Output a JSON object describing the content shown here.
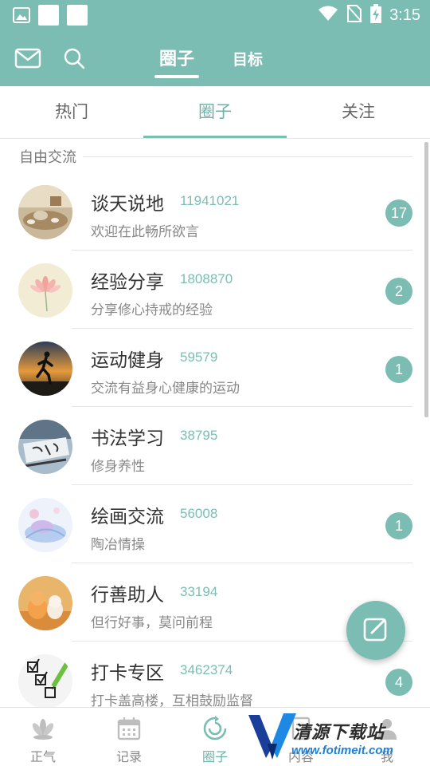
{
  "status_bar": {
    "time": "3:15"
  },
  "header": {
    "tabs": [
      {
        "label": "圈子",
        "active": true
      },
      {
        "label": "目标",
        "active": false
      }
    ]
  },
  "sub_tabs": [
    {
      "label": "热门",
      "active": false
    },
    {
      "label": "圈子",
      "active": true
    },
    {
      "label": "关注",
      "active": false
    }
  ],
  "section": {
    "title": "自由交流"
  },
  "circles": [
    {
      "name": "谈天说地",
      "members": "11941021",
      "desc": "欢迎在此畅所欲言",
      "badge": "17",
      "avatar": "tea-set-icon"
    },
    {
      "name": "经验分享",
      "members": "1808870",
      "desc": "分享修心持戒的经验",
      "badge": "2",
      "avatar": "lotus-icon"
    },
    {
      "name": "运动健身",
      "members": "59579",
      "desc": "交流有益身心健康的运动",
      "badge": "1",
      "avatar": "runner-sunset-icon"
    },
    {
      "name": "书法学习",
      "members": "38795",
      "desc": "修身养性",
      "badge": "",
      "avatar": "calligraphy-brush-icon"
    },
    {
      "name": "绘画交流",
      "members": "56008",
      "desc": "陶冶情操",
      "badge": "1",
      "avatar": "painting-icon"
    },
    {
      "name": "行善助人",
      "members": "33194",
      "desc": "但行好事，莫问前程",
      "badge": "",
      "avatar": "kittens-icon"
    },
    {
      "name": "打卡专区",
      "members": "3462374",
      "desc": "打卡盖高楼，互相鼓励监督",
      "badge": "4",
      "avatar": "checklist-pencil-icon"
    }
  ],
  "bottom_nav": [
    {
      "label": "正气",
      "icon": "lotus-icon",
      "active": false
    },
    {
      "label": "记录",
      "icon": "calendar-icon",
      "active": false
    },
    {
      "label": "圈子",
      "icon": "circle-refresh-icon",
      "active": true
    },
    {
      "label": "内容",
      "icon": "document-icon",
      "active": false
    },
    {
      "label": "我",
      "icon": "person-icon",
      "active": false
    }
  ],
  "watermark": {
    "title": "清源下载站",
    "url": "www.fotimeit.com"
  },
  "colors": {
    "accent": "#7bbdb3",
    "accent_text": "#6bb2a8"
  }
}
